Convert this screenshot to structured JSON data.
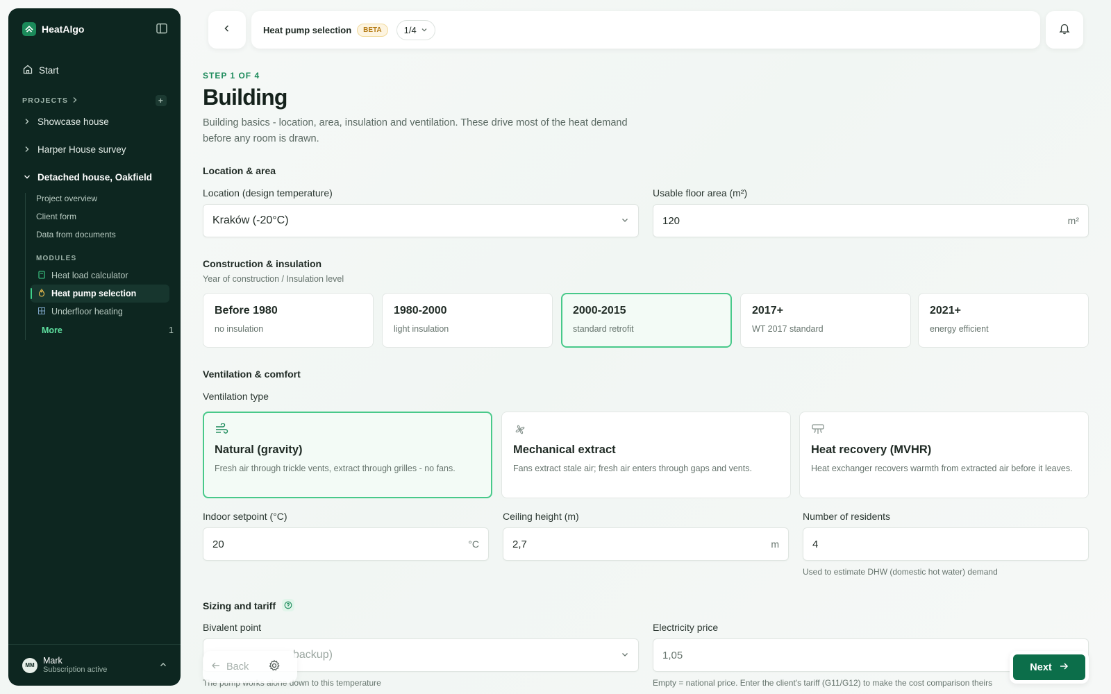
{
  "app": {
    "name": "HeatAlgo"
  },
  "sidebar": {
    "start": "Start",
    "projects_label": "PROJECTS",
    "projects": [
      {
        "label": "Showcase house"
      },
      {
        "label": "Harper House survey"
      },
      {
        "label": "Detached house, Oakfield"
      }
    ],
    "subitems": [
      "Project overview",
      "Client form",
      "Data from documents"
    ],
    "modules_label": "MODULES",
    "modules": [
      {
        "label": "Heat load calculator"
      },
      {
        "label": "Heat pump selection"
      },
      {
        "label": "Underfloor heating"
      }
    ],
    "more_label": "More",
    "more_count": "1",
    "user": {
      "initials": "MM",
      "name": "Mark",
      "status": "Subscription active"
    }
  },
  "topbar": {
    "title": "Heat pump selection",
    "badge": "BETA",
    "pager": "1/4"
  },
  "page": {
    "step": "STEP 1 OF 4",
    "title": "Building",
    "description": "Building basics - location, area, insulation and ventilation. These drive most of the heat demand before any room is drawn."
  },
  "location": {
    "section": "Location & area",
    "loc_label": "Location (design temperature)",
    "loc_value": "Kraków (-20°C)",
    "area_label": "Usable floor area (m²)",
    "area_value": "120",
    "area_unit": "m²"
  },
  "construction": {
    "section": "Construction & insulation",
    "sub": "Year of construction / Insulation level",
    "options": [
      {
        "title": "Before 1980",
        "sub": "no insulation"
      },
      {
        "title": "1980-2000",
        "sub": "light insulation"
      },
      {
        "title": "2000-2015",
        "sub": "standard retrofit"
      },
      {
        "title": "2017+",
        "sub": "WT 2017 standard"
      },
      {
        "title": "2021+",
        "sub": "energy efficient"
      }
    ],
    "selected": "2000-2015"
  },
  "ventilation": {
    "section": "Ventilation & comfort",
    "type_label": "Ventilation type",
    "options": [
      {
        "title": "Natural (gravity)",
        "desc": "Fresh air through trickle vents, extract through grilles - no fans.",
        "icon": "wind-icon"
      },
      {
        "title": "Mechanical extract",
        "desc": "Fans extract stale air; fresh air enters through gaps and vents.",
        "icon": "fan-icon"
      },
      {
        "title": "Heat recovery (MVHR)",
        "desc": "Heat exchanger recovers warmth from extracted air before it leaves.",
        "icon": "air-vent-icon"
      }
    ],
    "selected": "Natural (gravity)"
  },
  "comfort": {
    "setpoint_label": "Indoor setpoint (°C)",
    "setpoint_value": "20",
    "setpoint_unit": "°C",
    "ceiling_label": "Ceiling height (m)",
    "ceiling_value": "2,7",
    "ceiling_unit": "m",
    "residents_label": "Number of residents",
    "residents_value": "4",
    "residents_hint": "Used to estimate DHW (domestic hot water) demand"
  },
  "sizing": {
    "section": "Sizing and tariff",
    "bivalent_label": "Bivalent point",
    "bivalent_value": "backup)",
    "bivalent_hint": "The pump works alone down to this temperature",
    "price_label": "Electricity price",
    "price_value": "1,05",
    "price_hint": "Empty = national price. Enter the client's tariff (G11/G12) to make the cost comparison theirs"
  },
  "footer": {
    "back_label": "Back",
    "next_label": "Next"
  },
  "colors": {
    "accent": "#1b8a5a",
    "sidebar_bg": "#0d2620",
    "selected_border": "#48c98a",
    "next_button": "#0c6e4a"
  }
}
